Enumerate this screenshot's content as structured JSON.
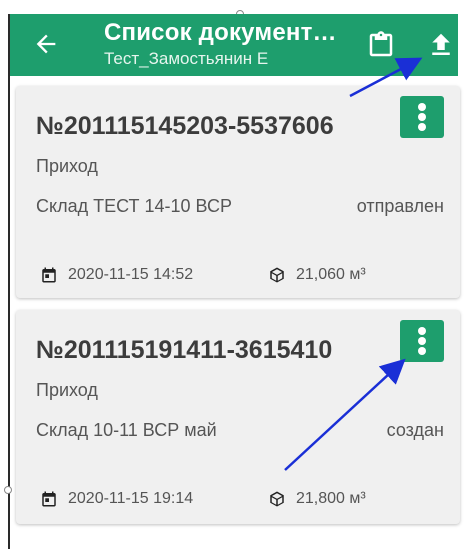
{
  "appbar": {
    "title": "Список документ…",
    "subtitle": "Тест_Замостьянин Е",
    "background": "#1e9e6d"
  },
  "icons": {
    "back": "arrow-back-icon",
    "clipboard": "clipboard-icon",
    "upload": "upload-icon",
    "menu": "more-vertical-icon",
    "date": "calendar-icon",
    "volume": "cube-icon"
  },
  "documents": [
    {
      "number": "№201115145203-5537606",
      "type": "Приход",
      "warehouse": "Склад ТЕСТ 14-10 ВСР",
      "status": "отправлен",
      "date": "2020-11-15 14:52",
      "volume": "21,060 м³"
    },
    {
      "number": "№201115191411-3615410",
      "type": "Приход",
      "warehouse": "Склад 10-11 ВСР май",
      "status": "создан",
      "date": "2020-11-15 19:14",
      "volume": "21,800 м³"
    }
  ],
  "annotation_color": "#1a2fd6"
}
